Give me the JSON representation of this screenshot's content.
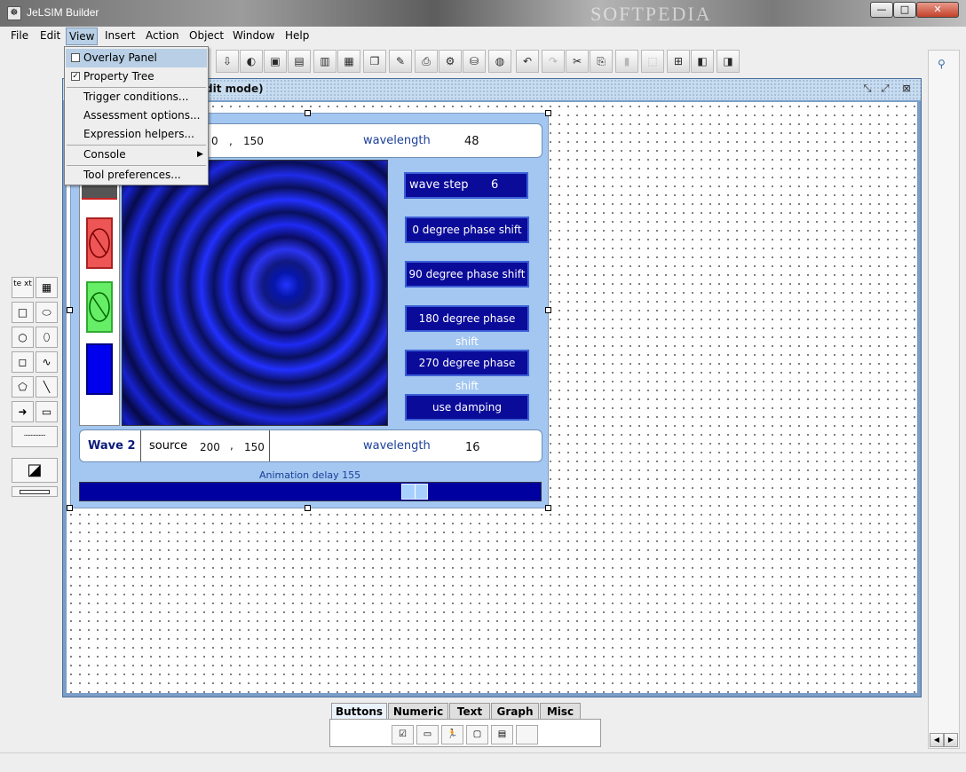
{
  "window": {
    "title": "JeLSIM Builder",
    "watermark": "SOFTPEDIA"
  },
  "window_controls": {
    "minimize": "—",
    "maximize": "□",
    "close": "✕"
  },
  "menubar": [
    "File",
    "Edit",
    "View",
    "Insert",
    "Action",
    "Object",
    "Window",
    "Help"
  ],
  "view_menu": {
    "items": [
      {
        "label": "Overlay Panel",
        "checked": false,
        "highlighted": true
      },
      {
        "label": "Property Tree",
        "checked": true
      },
      {
        "label": "Trigger conditions..."
      },
      {
        "label": "Assessment options..."
      },
      {
        "label": "Expression helpers..."
      },
      {
        "label": "Console",
        "submenu": true
      },
      {
        "label": "Tool preferences..."
      }
    ],
    "check_mark": "✓",
    "submenu_arrow": "▶"
  },
  "toolbar": {
    "icons": [
      "import-icon",
      "paint-icon",
      "open-icon",
      "save-icon",
      "save-as-icon",
      "export-icon",
      "copy-page-icon",
      "edit-page-icon",
      "print-icon",
      "settings-icon",
      "database-icon",
      "globe-icon",
      "undo-icon",
      "redo-icon",
      "cut-icon",
      "copy-icon",
      "paste-icon",
      "select-icon",
      "group-icon",
      "bring-front-icon",
      "send-back-icon"
    ],
    "glyphs": [
      "⇩",
      "◐",
      "▣",
      "▤",
      "▥",
      "▦",
      "❐",
      "✎",
      "⎙",
      "⚙",
      "⛁",
      "◍",
      "↶",
      "↷",
      "✂",
      "⎘",
      "▮",
      "⬚",
      "⊞",
      "◧",
      "◨"
    ],
    "disabled": [
      13,
      16,
      17
    ]
  },
  "internal_frame": {
    "title": "dit mode)",
    "controls": {
      "minimize": "⤡",
      "maximize": "⤢",
      "close": "⊠"
    }
  },
  "simulation": {
    "wave1": {
      "source_y": "0",
      "comma": ",",
      "source_y2": "150",
      "wavelength_label": "wavelength",
      "wavelength": "48"
    },
    "wave2": {
      "title": "Wave 2",
      "source_label": "source",
      "source_x": "200",
      "comma": ",",
      "source_y": "150",
      "wavelength_label": "wavelength",
      "wavelength": "16"
    },
    "wave_step": {
      "label": "wave step",
      "value": "6"
    },
    "buttons": [
      "0 degree phase shift",
      "90 degree phase shift",
      "180 degree phase shift",
      "270 degree phase shift",
      "use damping"
    ],
    "animation_delay": {
      "label": "Animation delay",
      "value": "155"
    },
    "slider_fraction": 0.74
  },
  "palette": {
    "tools": [
      {
        "name": "text-tool",
        "glyph": "te xt"
      },
      {
        "name": "image-tool",
        "glyph": "▦"
      },
      {
        "name": "rectangle-tool",
        "glyph": "□"
      },
      {
        "name": "rounded-rect-tool",
        "glyph": "⬭"
      },
      {
        "name": "circle-tool",
        "glyph": "○"
      },
      {
        "name": "ellipse-tool",
        "glyph": "⬯"
      },
      {
        "name": "square-tool",
        "glyph": "◻"
      },
      {
        "name": "curve-tool",
        "glyph": "∿"
      },
      {
        "name": "polygon-tool",
        "glyph": "⬠"
      },
      {
        "name": "line-tool",
        "glyph": "╲"
      },
      {
        "name": "arrow-tool",
        "glyph": "➜"
      },
      {
        "name": "button-tool",
        "glyph": "▭"
      }
    ],
    "dash_tool": "┈┈┈┈",
    "color_tool": "◪"
  },
  "bottom_tabs": {
    "tabs": [
      "Buttons",
      "Numeric",
      "Text",
      "Graph",
      "Misc"
    ],
    "active": 0,
    "component_icons": [
      {
        "name": "checkbox-component-icon",
        "glyph": "☑"
      },
      {
        "name": "button-component-icon",
        "glyph": "▭"
      },
      {
        "name": "runner-component-icon",
        "glyph": "🏃"
      },
      {
        "name": "frame-component-icon",
        "glyph": "▢"
      },
      {
        "name": "toggle-component-icon",
        "glyph": "▤"
      },
      {
        "name": "empty-slot-icon",
        "glyph": ""
      }
    ]
  },
  "right_pane": {
    "pin_glyph": "⚲",
    "left_arrow": "◀",
    "right_arrow": "▶"
  },
  "colors": {
    "accent": "#b8cfe5",
    "sim_bg": "#a3c7f0",
    "sim_button": "#0b0b9a",
    "frame_border": "#7a9ec8"
  }
}
